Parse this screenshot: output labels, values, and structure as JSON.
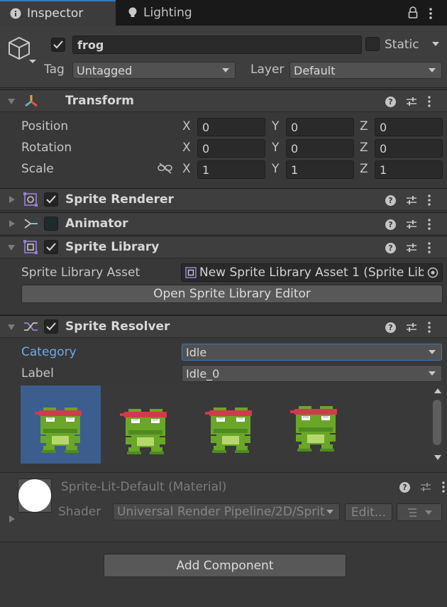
{
  "tabs": {
    "inspector": "Inspector",
    "lighting": "Lighting"
  },
  "object": {
    "name": "frog",
    "static_label": "Static",
    "tag_label": "Tag",
    "tag_value": "Untagged",
    "layer_label": "Layer",
    "layer_value": "Default"
  },
  "transform": {
    "title": "Transform",
    "rows": [
      {
        "label": "Position",
        "x": "0",
        "y": "0",
        "z": "0"
      },
      {
        "label": "Rotation",
        "x": "0",
        "y": "0",
        "z": "0"
      },
      {
        "label": "Scale",
        "x": "1",
        "y": "1",
        "z": "1"
      }
    ],
    "axis": {
      "x": "X",
      "y": "Y",
      "z": "Z"
    }
  },
  "sprite_renderer": {
    "title": "Sprite Renderer"
  },
  "animator": {
    "title": "Animator"
  },
  "sprite_library": {
    "title": "Sprite Library",
    "asset_label": "Sprite Library Asset",
    "asset_value": "New Sprite Library Asset 1 (Sprite Lib",
    "open_button": "Open Sprite Library Editor"
  },
  "sprite_resolver": {
    "title": "Sprite Resolver",
    "category_label": "Category",
    "category_value": "Idle",
    "label_label": "Label",
    "label_value": "Idle_0"
  },
  "material": {
    "title": "Sprite-Lit-Default (Material)",
    "shader_label": "Shader",
    "shader_value": "Universal Render Pipeline/2D/Sprit",
    "edit_button": "Edit..."
  },
  "add_component": "Add Component",
  "colors": {
    "accent": "#3a79bb",
    "category_label": "#6ea9e6",
    "selected_sprite_bg": "#3b5e8e",
    "frog_green": "#6aa628",
    "headband": "#d23a4c"
  }
}
